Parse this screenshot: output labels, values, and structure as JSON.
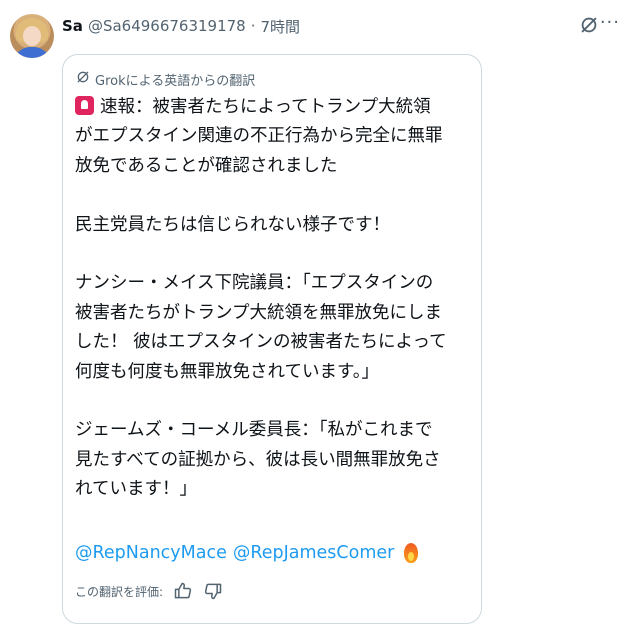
{
  "author": {
    "name": "Sa",
    "handle": "@Sa6496676319178",
    "separator": "·",
    "time": "7時間"
  },
  "card": {
    "label": "Grokによる英語からの翻訳",
    "lines": [
      "速報：被害者たちによってトランプ大統領",
      "がエプスタイン関連の不正行為から完全に無罪",
      "放免であることが確認されました",
      "",
      "民主党員たちは信じられない様子です！",
      "",
      "ナンシー・メイス下院議員：「エプスタインの",
      "被害者たちがトランプ大統領を無罪放免にしま",
      "した！ 彼はエプスタインの被害者たちによって",
      "何度も何度も無罪放免されています。」",
      "",
      "ジェームズ・コーメル委員長：「私がこれまで",
      "見たすべての証拠から、彼は長い間無罪放免さ",
      "れています！」"
    ],
    "mentions": [
      "@RepNancyMace",
      "@RepJamesComer"
    ],
    "rate_label": "この翻訳を評価:"
  },
  "icons": {
    "grok": "grok-icon",
    "more": "more-icon",
    "alarm": "rotating-light-emoji",
    "fire": "fire-emoji",
    "thumbs_up": "thumbs-up-icon",
    "thumbs_down": "thumbs-down-icon"
  },
  "colors": {
    "link": "#1d9bf0",
    "muted": "#536471",
    "text": "#0f1419",
    "border": "#cfd9de"
  }
}
